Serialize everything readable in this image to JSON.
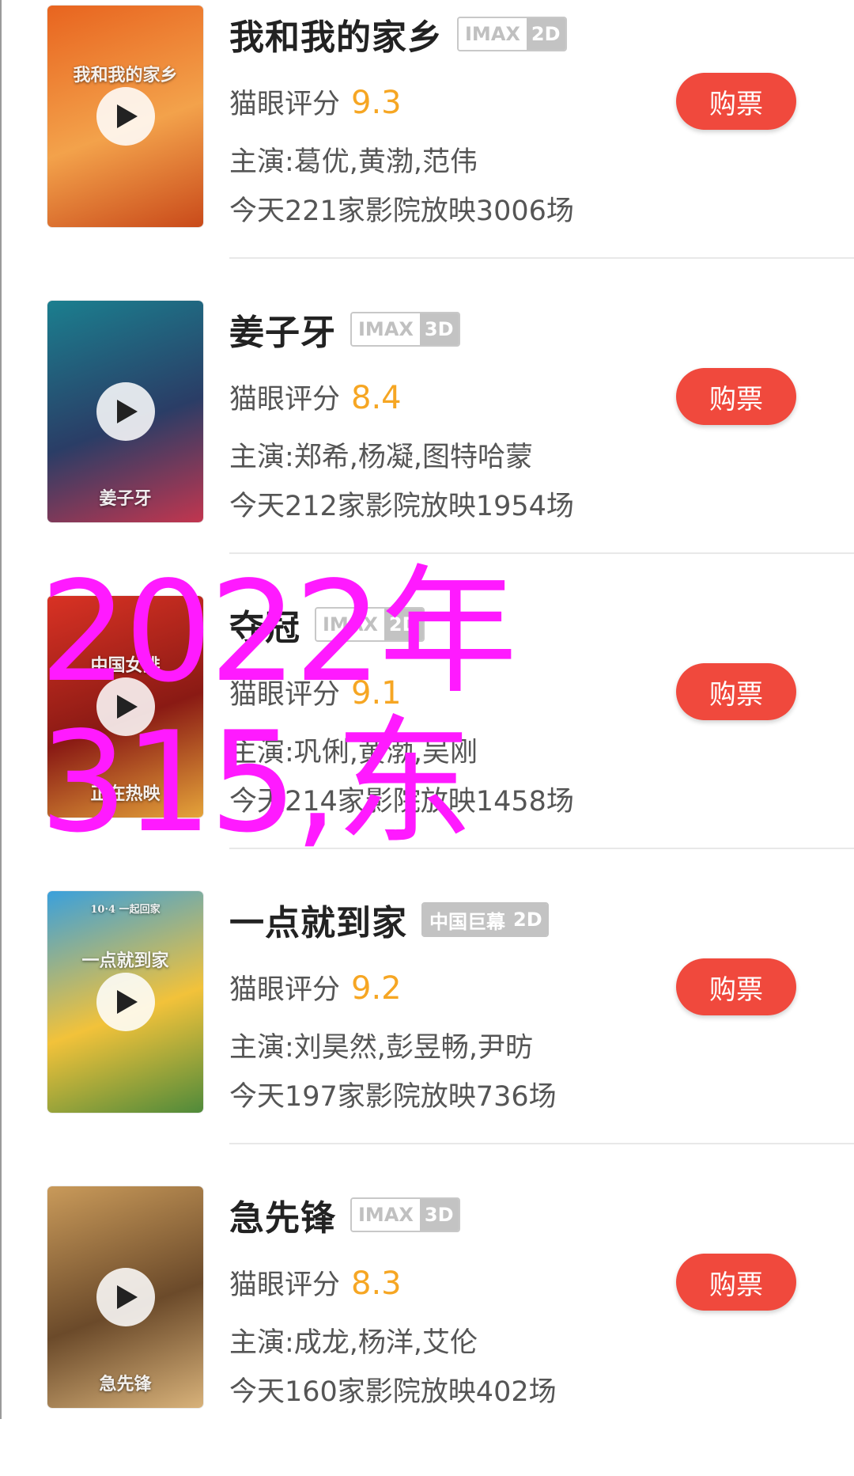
{
  "colors": {
    "accent": "#f0493d",
    "score": "#f6a623",
    "watermark": "#ff1aff"
  },
  "movies": [
    {
      "title": "我和我的家乡",
      "badge": {
        "format": "IMAX",
        "dim": "2D",
        "style": "outline"
      },
      "score_label": "猫眼评分",
      "score": "9.3",
      "cast": "主演:葛优,黄渤,范伟",
      "showings": "今天221家影院放映3006场",
      "buy_label": "购票",
      "poster": {
        "top_text": "",
        "mid_text": "我和我的家乡",
        "bottom_text": "",
        "colors": [
          "#e8641f",
          "#f3a24b",
          "#c94a1a"
        ]
      }
    },
    {
      "title": "姜子牙",
      "badge": {
        "format": "IMAX",
        "dim": "3D",
        "style": "outline"
      },
      "score_label": "猫眼评分",
      "score": "8.4",
      "cast": "主演:郑希,杨凝,图特哈蒙",
      "showings": "今天212家影院放映1954场",
      "buy_label": "购票",
      "poster": {
        "top_text": "",
        "mid_text": "",
        "bottom_text": "姜子牙",
        "colors": [
          "#1b7f8f",
          "#2a3d66",
          "#c2364f"
        ]
      }
    },
    {
      "title": "夺冠",
      "badge": {
        "format": "IMAX",
        "dim": "2D",
        "style": "outline"
      },
      "score_label": "猫眼评分",
      "score": "9.1",
      "cast": "主演:巩俐,黄渤,吴刚",
      "showings": "今天214家影院放映1458场",
      "buy_label": "购票",
      "poster": {
        "top_text": "",
        "mid_text": "中国女排",
        "bottom_text": "正在热映",
        "colors": [
          "#d93224",
          "#8a1a14",
          "#e5a43a"
        ]
      }
    },
    {
      "title": "一点就到家",
      "badge": {
        "format": "中国巨幕",
        "dim": "2D",
        "style": "solid"
      },
      "score_label": "猫眼评分",
      "score": "9.2",
      "cast": "主演:刘昊然,彭昱畅,尹昉",
      "showings": "今天197家影院放映736场",
      "buy_label": "购票",
      "poster": {
        "top_text": "10·4 一起回家",
        "mid_text": "一点就到家",
        "bottom_text": "",
        "colors": [
          "#3aa0dc",
          "#f2c23a",
          "#4f8a3a"
        ]
      }
    },
    {
      "title": "急先锋",
      "badge": {
        "format": "IMAX",
        "dim": "3D",
        "style": "outline"
      },
      "score_label": "猫眼评分",
      "score": "8.3",
      "cast": "主演:成龙,杨洋,艾伦",
      "showings": "今天160家影院放映402场",
      "buy_label": "购票",
      "poster": {
        "top_text": "",
        "mid_text": "",
        "bottom_text": "急先锋",
        "colors": [
          "#c99a5a",
          "#6b4a2a",
          "#d8b27a"
        ]
      }
    }
  ],
  "watermark": {
    "line1": "2022年",
    "line2": "315,东"
  }
}
